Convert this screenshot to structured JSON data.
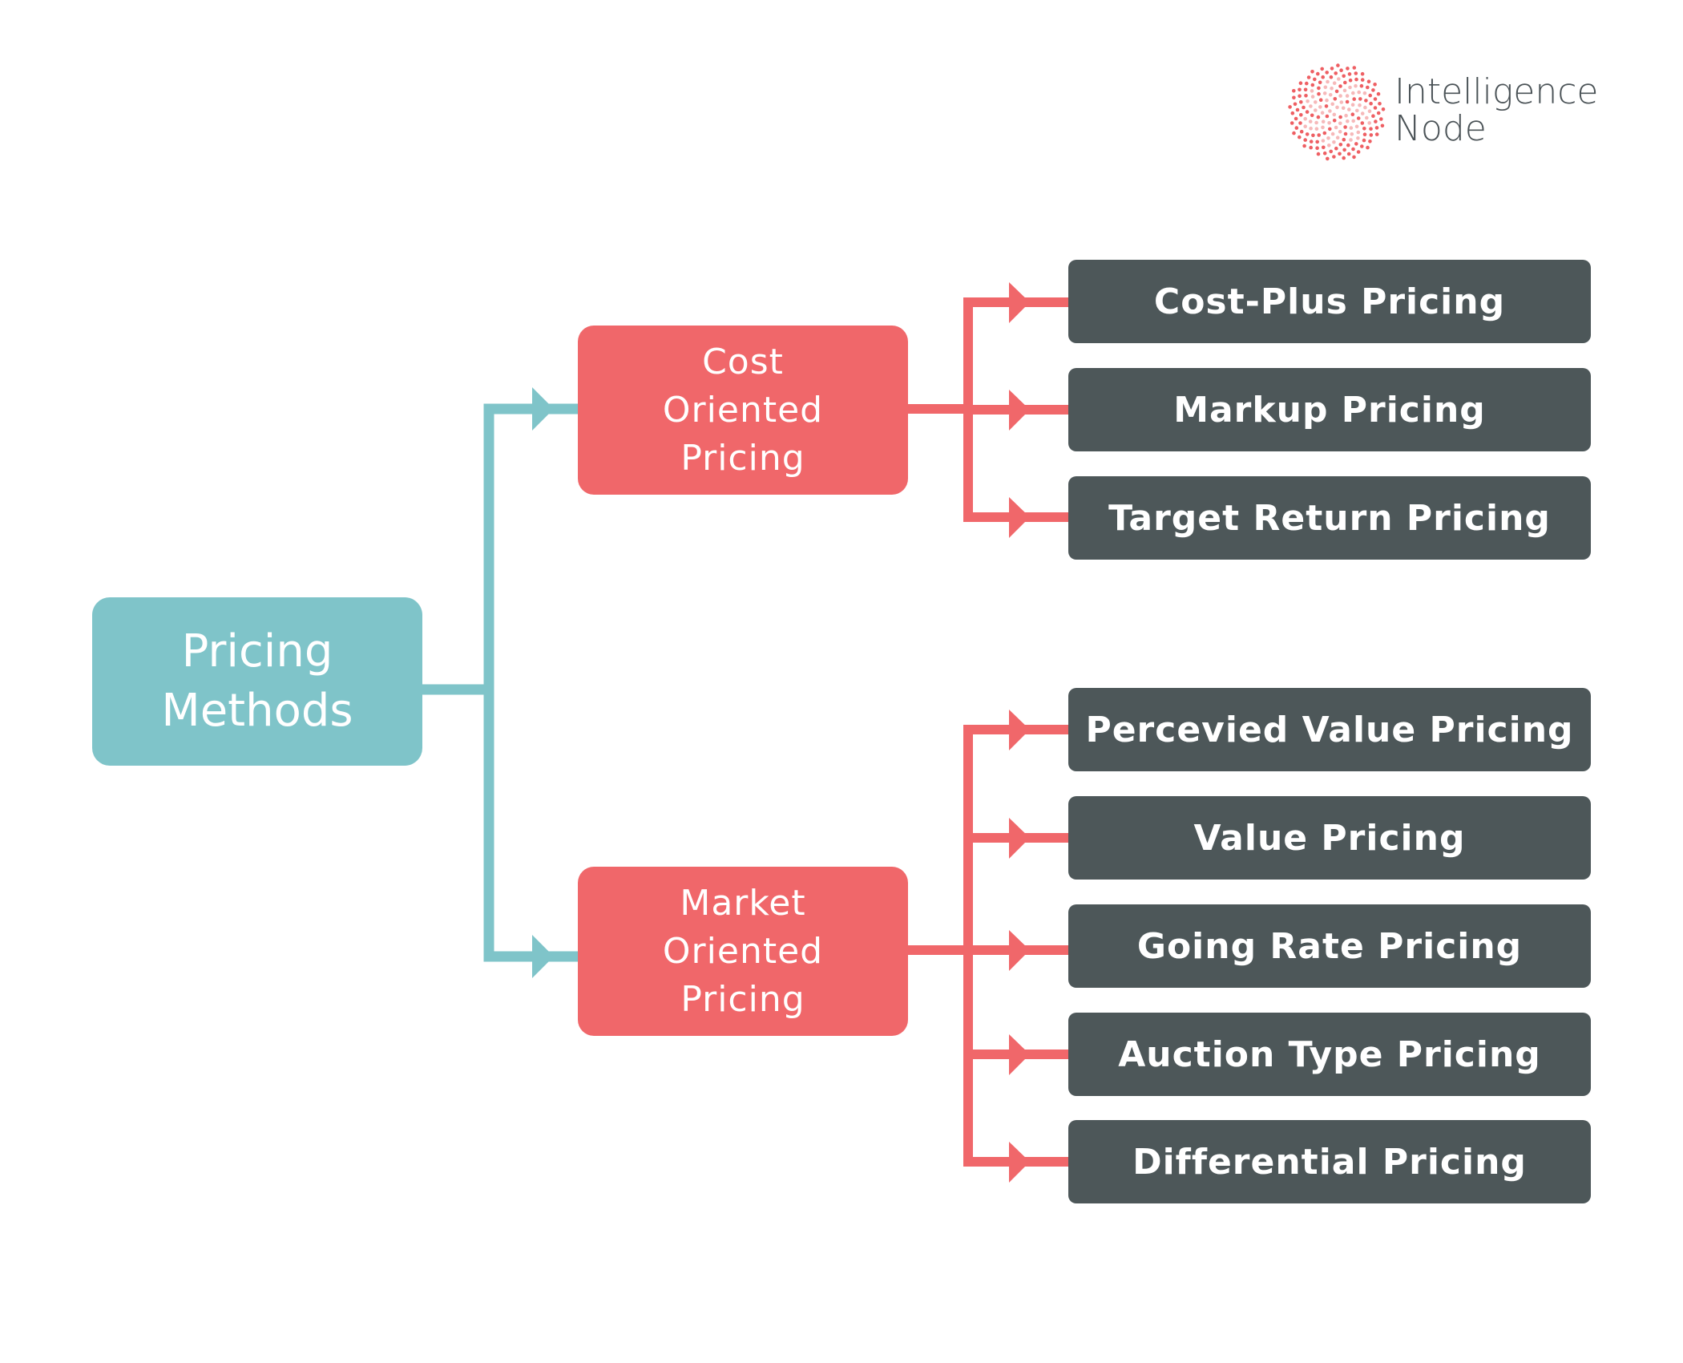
{
  "logo": {
    "line1": "Intelligence",
    "line2": "Node",
    "icon": "dotted-sphere-icon"
  },
  "colors": {
    "root": "#7fc4c9",
    "branch": "#f0676a",
    "leaf": "#4d5759",
    "teal_connector": "#7fc4c9",
    "red_connector": "#f0676a",
    "text": "#ffffff",
    "logo_text": "#4a5256"
  },
  "root": {
    "lines": [
      "Pricing",
      "Methods"
    ]
  },
  "branches": [
    {
      "lines": [
        "Cost",
        "Oriented",
        "Pricing"
      ],
      "children": [
        {
          "label": "Cost-Plus Pricing"
        },
        {
          "label": "Markup Pricing"
        },
        {
          "label": "Target Return Pricing"
        }
      ]
    },
    {
      "lines": [
        "Market",
        "Oriented",
        "Pricing"
      ],
      "children": [
        {
          "label": "Percevied Value Pricing"
        },
        {
          "label": "Value Pricing"
        },
        {
          "label": "Going Rate Pricing"
        },
        {
          "label": "Auction Type Pricing"
        },
        {
          "label": "Differential Pricing"
        }
      ]
    }
  ]
}
